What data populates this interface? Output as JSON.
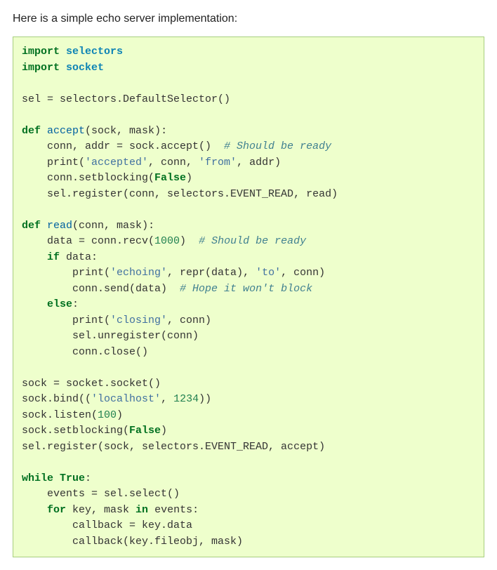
{
  "intro": "Here is a simple echo server implementation:",
  "code": {
    "l01_import": "import",
    "l01_mod": "selectors",
    "l02_import": "import",
    "l02_mod": "socket",
    "l04": "sel = selectors.DefaultSelector()",
    "l06_def": "def",
    "l06_fn": "accept",
    "l06_sig": "(sock, mask):",
    "l07_a": "    conn, addr = sock.accept()  ",
    "l07_cmt": "# Should be ready",
    "l08_a": "    print(",
    "l08_s1": "'accepted'",
    "l08_b": ", conn, ",
    "l08_s2": "'from'",
    "l08_c": ", addr)",
    "l09_a": "    conn.setblocking(",
    "l09_bv": "False",
    "l09_b": ")",
    "l10": "    sel.register(conn, selectors.EVENT_READ, read)",
    "l12_def": "def",
    "l12_fn": "read",
    "l12_sig": "(conn, mask):",
    "l13_a": "    data = conn.recv(",
    "l13_num": "1000",
    "l13_b": ")  ",
    "l13_cmt": "# Should be ready",
    "l14_if": "    if",
    "l14_a": " data:",
    "l15_a": "        print(",
    "l15_s1": "'echoing'",
    "l15_b": ", repr(data), ",
    "l15_s2": "'to'",
    "l15_c": ", conn)",
    "l16_a": "        conn.send(data)  ",
    "l16_cmt": "# Hope it won't block",
    "l17_else": "    else",
    "l17_a": ":",
    "l18_a": "        print(",
    "l18_s1": "'closing'",
    "l18_b": ", conn)",
    "l19": "        sel.unregister(conn)",
    "l20": "        conn.close()",
    "l22": "sock = socket.socket()",
    "l23_a": "sock.bind((",
    "l23_s": "'localhost'",
    "l23_b": ", ",
    "l23_num": "1234",
    "l23_c": "))",
    "l24_a": "sock.listen(",
    "l24_num": "100",
    "l24_b": ")",
    "l25_a": "sock.setblocking(",
    "l25_bv": "False",
    "l25_b": ")",
    "l26": "sel.register(sock, selectors.EVENT_READ, accept)",
    "l28_while": "while",
    "l28_bv": "True",
    "l28_a": ":",
    "l29": "    events = sel.select()",
    "l30_for": "    for",
    "l30_a": " key, mask ",
    "l30_in": "in",
    "l30_b": " events:",
    "l31": "        callback = key.data",
    "l32": "        callback(key.fileobj, mask)"
  }
}
